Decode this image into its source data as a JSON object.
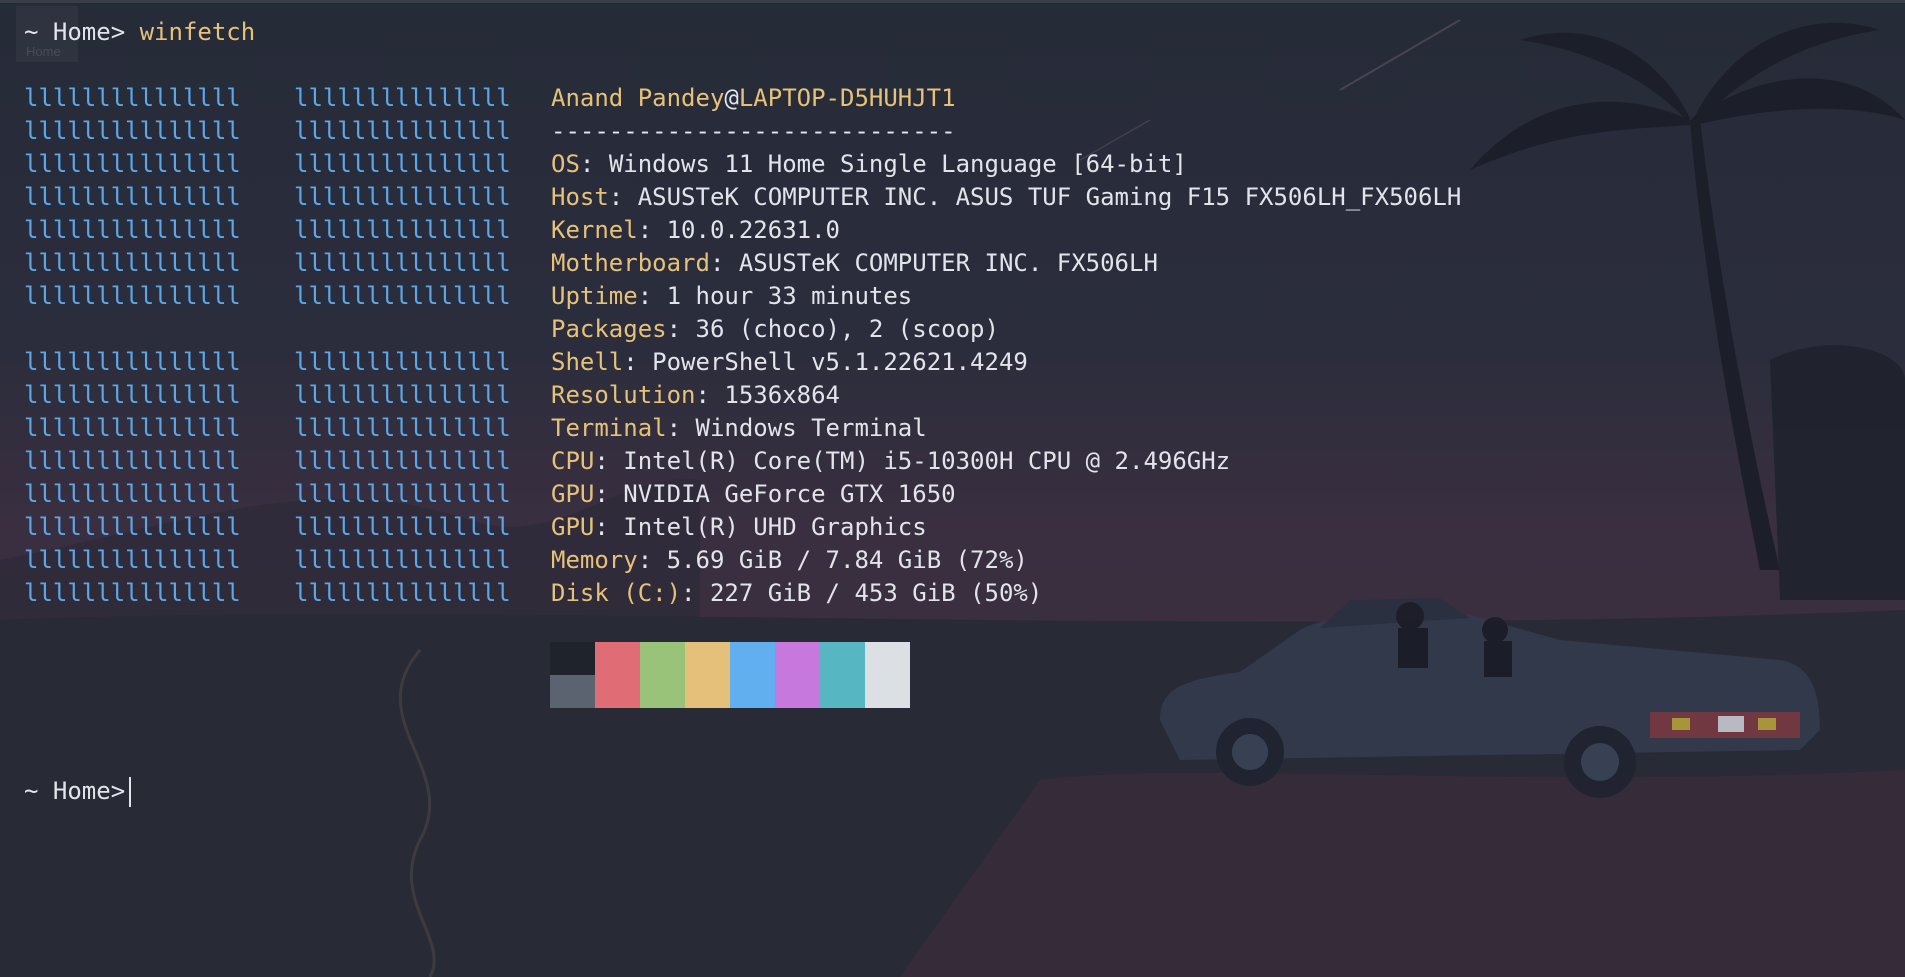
{
  "terminal": {
    "ghost_tab_label": "Home",
    "prompt": "~ Home>",
    "command": "winfetch",
    "logo_block": "lllllllllllllll"
  },
  "info": {
    "user": "Anand Pandey",
    "at": "@",
    "host": "LAPTOP-D5HUHJT1",
    "separator": "----------------------------",
    "fields": [
      {
        "key": "OS",
        "value": "Windows 11 Home Single Language [64-bit]"
      },
      {
        "key": "Host",
        "value": "ASUSTeK COMPUTER INC. ASUS TUF Gaming F15 FX506LH_FX506LH"
      },
      {
        "key": "Kernel",
        "value": "10.0.22631.0"
      },
      {
        "key": "Motherboard",
        "value": "ASUSTeK COMPUTER INC. FX506LH"
      },
      {
        "key": "Uptime",
        "value": "1 hour 33 minutes"
      },
      {
        "key": "Packages",
        "value": "36 (choco), 2 (scoop)"
      },
      {
        "key": "Shell",
        "value": "PowerShell v5.1.22621.4249"
      },
      {
        "key": "Resolution",
        "value": "1536x864"
      },
      {
        "key": "Terminal",
        "value": "Windows Terminal"
      },
      {
        "key": "CPU",
        "value": "Intel(R) Core(TM) i5-10300H CPU @ 2.496GHz"
      },
      {
        "key": "GPU",
        "value": "NVIDIA GeForce GTX 1650"
      },
      {
        "key": "GPU",
        "value": "Intel(R) UHD Graphics"
      },
      {
        "key": "Memory",
        "value": "5.69 GiB / 7.84 GiB (72%)"
      },
      {
        "key": "Disk (C:)",
        "value": "227 GiB / 453 GiB (50%)"
      }
    ]
  },
  "palette": {
    "top": [
      "#1f232c",
      "#e06c75",
      "#98c379",
      "#e5c07b",
      "#61afef",
      "#c678dd",
      "#56b6c2",
      "#dcdfe4"
    ],
    "bottom": [
      "#5c6370",
      "#e06c75",
      "#98c379",
      "#e5c07b",
      "#61afef",
      "#c678dd",
      "#56b6c2",
      "#dcdfe4"
    ]
  },
  "colors": {
    "key": "#e6c17a",
    "text": "#e2e4ea",
    "logo": "#5ca7e8",
    "background": "#262a36"
  }
}
